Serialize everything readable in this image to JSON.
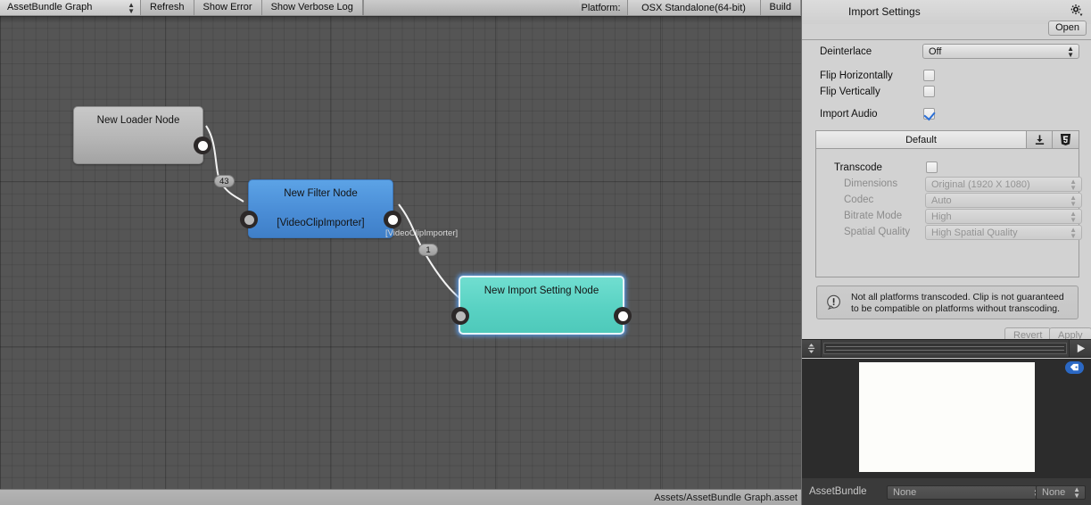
{
  "graph": {
    "toolbar": {
      "graph_selector_value": "AssetBundle Graph",
      "refresh_label": "Refresh",
      "show_error_label": "Show Error",
      "show_verbose_log_label": "Show Verbose Log",
      "platform_label": "Platform:",
      "platform_value": "OSX Standalone(64-bit)",
      "build_label": "Build"
    },
    "status_path": "Assets/AssetBundle Graph.asset",
    "nodes": [
      {
        "title": "New Loader Node",
        "subtitle": "",
        "color": "#b6b6b6"
      },
      {
        "title": "New Filter Node",
        "subtitle": "[VideoClipImporter]",
        "color": "#4a8dd6"
      },
      {
        "title": "New Import Setting Node",
        "subtitle": "",
        "color": "#59d2c3"
      }
    ],
    "connections": [
      {
        "badge": "43",
        "label": ""
      },
      {
        "badge": "1",
        "label": "[VideoClipImporter]"
      }
    ]
  },
  "inspector": {
    "title": "Import Settings",
    "gear_icon": "gear-icon",
    "open_label": "Open",
    "fields": {
      "deinterlace_label": "Deinterlace",
      "deinterlace_value": "Off",
      "flip_horizontally_label": "Flip Horizontally",
      "flip_horizontally_checked": false,
      "flip_vertically_label": "Flip Vertically",
      "flip_vertically_checked": false,
      "import_audio_label": "Import Audio",
      "import_audio_checked": true
    },
    "platform_tabs": {
      "default_label": "Default",
      "icons": [
        "download-icon",
        "html5-icon"
      ]
    },
    "transcode": {
      "label": "Transcode",
      "checked": false,
      "dimensions_label": "Dimensions",
      "dimensions_value": "Original (1920 X 1080)",
      "codec_label": "Codec",
      "codec_value": "Auto",
      "bitrate_mode_label": "Bitrate Mode",
      "bitrate_mode_value": "High",
      "spatial_quality_label": "Spatial Quality",
      "spatial_quality_value": "High Spatial Quality"
    },
    "warning": {
      "icon": "warning-icon",
      "text": "Not all platforms transcoded. Clip is not guaranteed to be compatible on platforms without transcoding."
    },
    "buttons": {
      "revert_label": "Revert",
      "apply_label": "Apply"
    },
    "preview": {
      "frame_stepper_icon": "up-down-arrows-icon",
      "play_icon": "play-icon",
      "tag_icon": "tag-icon"
    },
    "assetbundle": {
      "label": "AssetBundle",
      "name_value": "None",
      "variant_value": "None"
    }
  },
  "colors": {
    "accent_blue": "#2b68c4",
    "node_filter": "#4a8dd6",
    "node_import": "#59d2c3",
    "canvas_bg": "#555555",
    "inspector_bg": "#d2d2d2"
  }
}
